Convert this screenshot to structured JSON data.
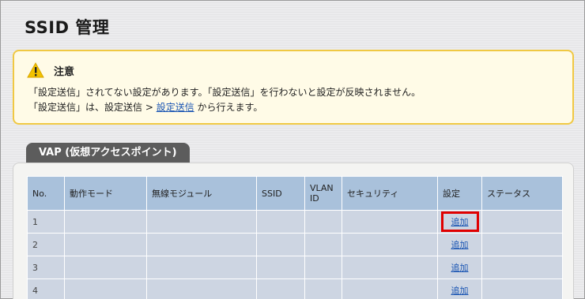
{
  "page": {
    "title": "SSID 管理"
  },
  "notice": {
    "title": "注意",
    "line1": "「設定送信」されてない設定があります。「設定送信」を行わないと設定が反映されません。",
    "line2_prefix": "「設定送信」は、設定送信 > ",
    "line2_link": "設定送信",
    "line2_suffix": " から行えます。",
    "icon": "warning-triangle-icon",
    "accent_color": "#f0c843"
  },
  "vap": {
    "tab_label": "VAP (仮想アクセスポイント)",
    "columns": [
      "No.",
      "動作モード",
      "無線モジュール",
      "SSID",
      "VLAN ID",
      "セキュリティ",
      "設定",
      "ステータス"
    ],
    "rows": [
      {
        "no": "1",
        "mode": "",
        "module": "",
        "ssid": "",
        "vlan": "",
        "security": "",
        "setting": "追加",
        "status": ""
      },
      {
        "no": "2",
        "mode": "",
        "module": "",
        "ssid": "",
        "vlan": "",
        "security": "",
        "setting": "追加",
        "status": ""
      },
      {
        "no": "3",
        "mode": "",
        "module": "",
        "ssid": "",
        "vlan": "",
        "security": "",
        "setting": "追加",
        "status": ""
      },
      {
        "no": "4",
        "mode": "",
        "module": "",
        "ssid": "",
        "vlan": "",
        "security": "",
        "setting": "追加",
        "status": ""
      }
    ],
    "highlight_color": "#e00000"
  }
}
